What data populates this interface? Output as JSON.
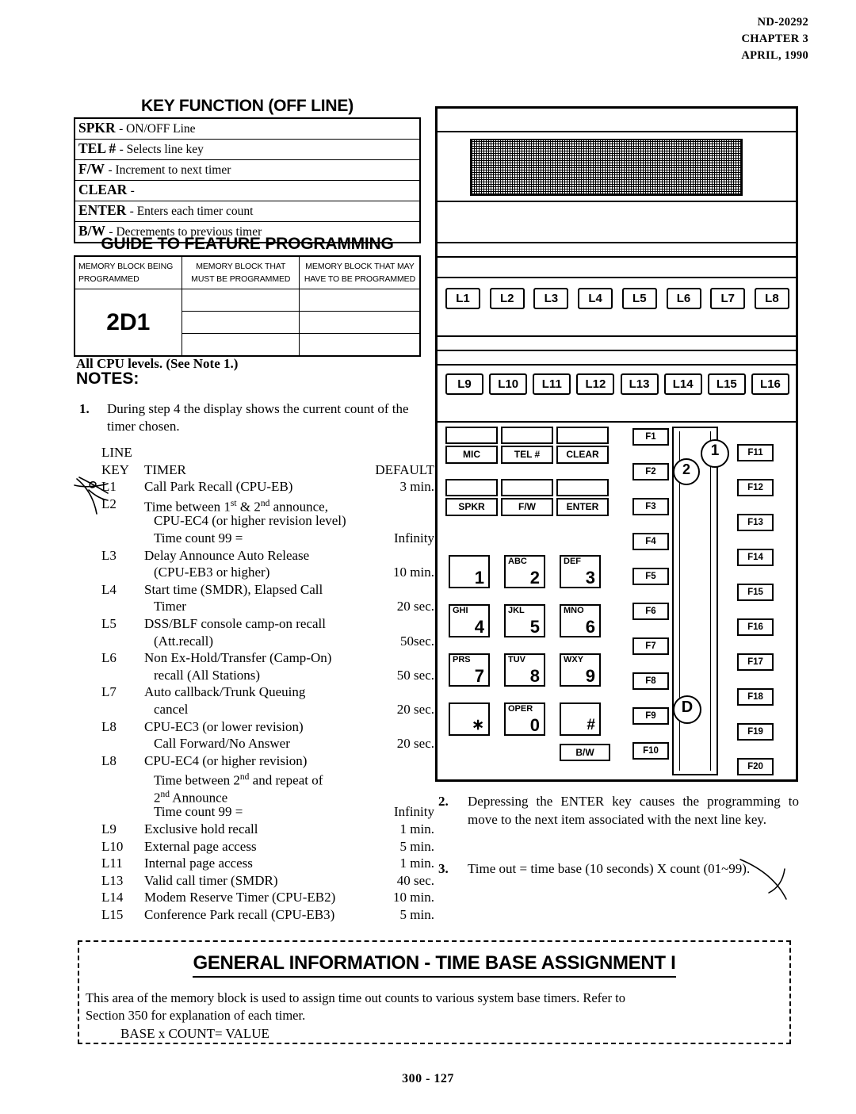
{
  "header": {
    "doc_id": "ND-20292",
    "chapter": "CHAPTER 3",
    "date": "APRIL, 1990"
  },
  "key_function": {
    "title": "KEY FUNCTION (OFF LINE)",
    "rows": [
      {
        "key": "SPKR",
        "desc": "-  ON/OFF Line"
      },
      {
        "key": "TEL #",
        "desc": "- Selects line key"
      },
      {
        "key": "F/W",
        "desc": "-  Increment to next timer"
      },
      {
        "key": "CLEAR",
        "desc": "-"
      },
      {
        "key": "ENTER",
        "desc": "-   Enters each timer count"
      },
      {
        "key": "B/W",
        "desc": "- Decrements to previous timer"
      }
    ]
  },
  "guide": {
    "title": "GUIDE TO FEATURE PROGRAMMING",
    "col1_line1": "MEMORY BLOCK BEING",
    "col1_line2": "PROGRAMMED",
    "col2_line1": "MEMORY BLOCK THAT",
    "col2_line2": "MUST BE PROGRAMMED",
    "col3_line1": "MEMORY BLOCK THAT MAY",
    "col3_line2": "HAVE TO BE PROGRAMMED",
    "memory_block": "2D1"
  },
  "cpu_note": "All CPU levels.  (See Note 1.)",
  "notes_heading": "NOTES:",
  "note1": {
    "number": "1.",
    "text": "During step 4 the display shows the current count of the timer chosen."
  },
  "timer_table": {
    "head_line1": "LINE",
    "head_key": "KEY",
    "head_timer": "TIMER",
    "head_default": "DEFAULT",
    "rows": [
      {
        "key": "L1",
        "timer": "Call Park Recall (CPU-EB)",
        "default": "3 min.",
        "indent": false
      },
      {
        "key": "L2",
        "timer": "Time between 1st & 2nd announce,",
        "default": "",
        "indent": false
      },
      {
        "key": "",
        "timer": "CPU-EC4 (or higher revision level)",
        "default": "",
        "indent": true
      },
      {
        "key": "",
        "timer": "Time count 99 =",
        "default": "Infinity",
        "indent": true
      },
      {
        "key": "L3",
        "timer": "Delay Announce Auto Release",
        "default": "",
        "indent": false
      },
      {
        "key": "",
        "timer": "(CPU-EB3 or higher)",
        "default": "10 min.",
        "indent": true
      },
      {
        "key": "L4",
        "timer": "Start time  (SMDR), Elapsed Call",
        "default": "",
        "indent": false
      },
      {
        "key": "",
        "timer": "Timer",
        "default": "20 sec.",
        "indent": true
      },
      {
        "key": "L5",
        "timer": "DSS/BLF console camp-on recall",
        "default": "",
        "indent": false
      },
      {
        "key": "",
        "timer": "(Att.recall)",
        "default": "50sec.",
        "indent": true
      },
      {
        "key": "L6",
        "timer": "Non Ex-Hold/Transfer (Camp-On)",
        "default": "",
        "indent": false
      },
      {
        "key": "",
        "timer": "recall (All Stations)",
        "default": "50 sec.",
        "indent": true
      },
      {
        "key": "L7",
        "timer": "Auto callback/Trunk Queuing",
        "default": "",
        "indent": false
      },
      {
        "key": "",
        "timer": "cancel",
        "default": "20 sec.",
        "indent": true
      },
      {
        "key": "L8",
        "timer": "CPU-EC3 (or lower revision)",
        "default": "",
        "indent": false
      },
      {
        "key": "",
        "timer": "Call Forward/No Answer",
        "default": "20 sec.",
        "indent": true
      },
      {
        "key": "L8",
        "timer": "CPU-EC4 (or higher revision)",
        "default": "",
        "indent": false
      },
      {
        "key": "",
        "timer": "Time between 2nd and repeat of",
        "default": "",
        "indent": true
      },
      {
        "key": "",
        "timer": "2nd  Announce",
        "default": "",
        "indent": true
      },
      {
        "key": "",
        "timer": "Time count 99 =",
        "default": "Infinity",
        "indent": true
      },
      {
        "key": "L9",
        "timer": "Exclusive hold recall",
        "default": "1 min.",
        "indent": false
      },
      {
        "key": "L10",
        "timer": "External page access",
        "default": "5 min.",
        "indent": false
      },
      {
        "key": "L11",
        "timer": "Internal page access",
        "default": "1 min.",
        "indent": false
      },
      {
        "key": "L13",
        "timer": "Valid call timer (SMDR)",
        "default": "40 sec.",
        "indent": false
      },
      {
        "key": "L14",
        "timer": "Modem Reserve Timer   (CPU-EB2)",
        "default": "10 min.",
        "indent": false
      },
      {
        "key": "L15",
        "timer": "Conference Park recall (CPU-EB3)",
        "default": "5 min.",
        "indent": false
      }
    ]
  },
  "phone": {
    "line_keys_row1": [
      "L1",
      "L2",
      "L3",
      "L4",
      "L5",
      "L6",
      "L7",
      "L8"
    ],
    "line_keys_row2": [
      "L9",
      "L10",
      "L11",
      "L12",
      "L13",
      "L14",
      "L15",
      "L16"
    ],
    "function_keys": [
      "MIC",
      "TEL #",
      "CLEAR",
      "SPKR",
      "F/W",
      "ENTER"
    ],
    "bw_key": "B/W",
    "dial_keys": [
      {
        "letters": "",
        "digit": "1"
      },
      {
        "letters": "ABC",
        "digit": "2"
      },
      {
        "letters": "DEF",
        "digit": "3"
      },
      {
        "letters": "GHI",
        "digit": "4"
      },
      {
        "letters": "JKL",
        "digit": "5"
      },
      {
        "letters": "MNO",
        "digit": "6"
      },
      {
        "letters": "PRS",
        "digit": "7"
      },
      {
        "letters": "TUV",
        "digit": "8"
      },
      {
        "letters": "WXY",
        "digit": "9"
      },
      {
        "letters": "",
        "digit": "∗"
      },
      {
        "letters": "OPER",
        "digit": "0"
      },
      {
        "letters": "",
        "digit": "#"
      }
    ],
    "f_keys_left": [
      "F1",
      "F2",
      "F3",
      "F4",
      "F5",
      "F6",
      "F7",
      "F8",
      "F9",
      "F10"
    ],
    "f_keys_right": [
      "F11",
      "F12",
      "F13",
      "F14",
      "F15",
      "F16",
      "F17",
      "F18",
      "F19",
      "F20"
    ],
    "markers": [
      "1",
      "2",
      "D"
    ]
  },
  "note2": {
    "number": "2.",
    "text": "Depressing the ENTER key causes the programming to move to the next item associated with the next line key."
  },
  "note3": {
    "number": "3.",
    "text": "Time out = time base  (10 seconds) X count (01~99)."
  },
  "general_info": {
    "title": "GENERAL INFORMATION - TIME BASE ASSIGNMENT I",
    "body_line1": "This area of the memory block is used to assign time out counts to various system base timers.  Refer to",
    "body_line2": "Section 350 for explanation of each timer.",
    "formula": "BASE x COUNT= VALUE"
  },
  "footer": "300 - 127"
}
